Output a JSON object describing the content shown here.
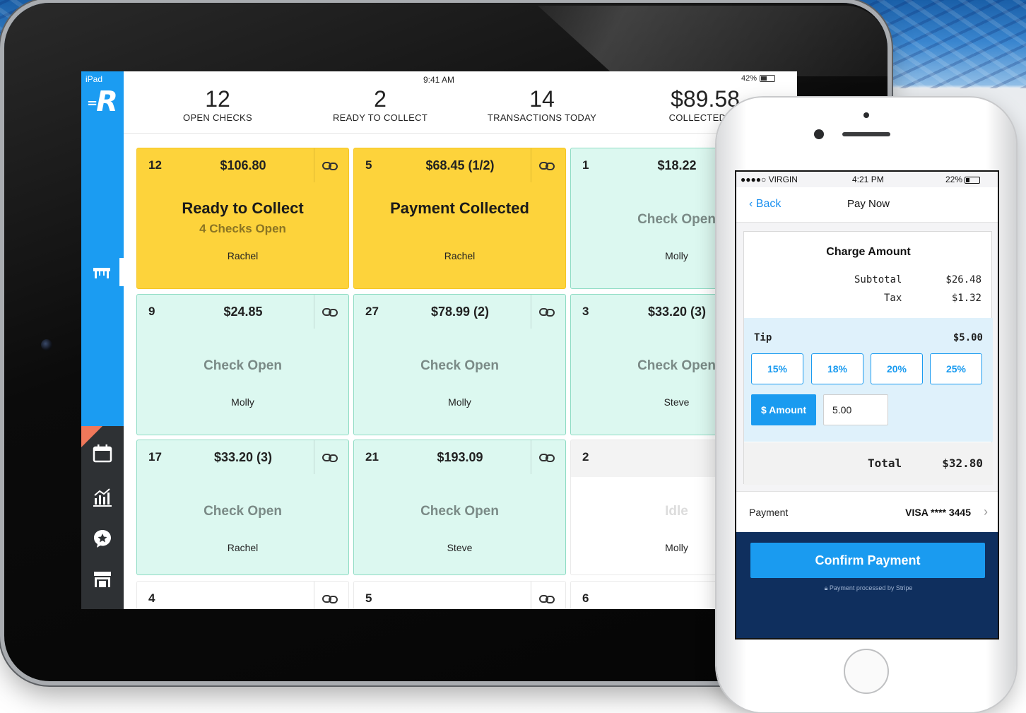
{
  "ipad": {
    "status": {
      "left": "iPad",
      "time": "9:41 AM",
      "battery": "42%"
    },
    "stats": [
      {
        "value": "12",
        "label": "OPEN CHECKS"
      },
      {
        "value": "2",
        "label": "READY TO COLLECT"
      },
      {
        "value": "14",
        "label": "TRANSACTIONS TODAY"
      },
      {
        "value": "$89.58",
        "label": "COLLECTED TO"
      }
    ],
    "cards": [
      {
        "num": "12",
        "amount": "$106.80",
        "status": "Ready to Collect",
        "sub": "4 Checks Open",
        "server": "Rachel",
        "style": "yellow",
        "linked": true
      },
      {
        "num": "5",
        "amount": "$68.45 (1/2)",
        "status": "Payment Collected",
        "sub": "",
        "server": "Rachel",
        "style": "yellow",
        "linked": true
      },
      {
        "num": "1",
        "amount": "$18.22",
        "status": "Check Open",
        "sub": "",
        "server": "Molly",
        "style": "mint",
        "linked": false
      },
      {
        "num": "9",
        "amount": "$24.85",
        "status": "Check Open",
        "sub": "",
        "server": "Molly",
        "style": "mint",
        "linked": true
      },
      {
        "num": "27",
        "amount": "$78.99 (2)",
        "status": "Check Open",
        "sub": "",
        "server": "Molly",
        "style": "mint",
        "linked": true
      },
      {
        "num": "3",
        "amount": "$33.20 (3)",
        "status": "Check Open",
        "sub": "",
        "server": "Steve",
        "style": "mint",
        "linked": false
      },
      {
        "num": "17",
        "amount": "$33.20 (3)",
        "status": "Check Open",
        "sub": "",
        "server": "Rachel",
        "style": "mint",
        "linked": true
      },
      {
        "num": "21",
        "amount": "$193.09",
        "status": "Check Open",
        "sub": "",
        "server": "Steve",
        "style": "mint",
        "linked": true
      },
      {
        "num": "2",
        "amount": "",
        "status": "Idle",
        "sub": "",
        "server": "Molly",
        "style": "idle",
        "linked": false
      },
      {
        "num": "4",
        "amount": "",
        "status": "",
        "sub": "",
        "server": "",
        "style": "idle",
        "linked": true
      },
      {
        "num": "5",
        "amount": "",
        "status": "",
        "sub": "",
        "server": "",
        "style": "idle",
        "linked": true
      },
      {
        "num": "6",
        "amount": "",
        "status": "",
        "sub": "",
        "server": "",
        "style": "idle",
        "linked": false
      }
    ],
    "sidebar_icons": [
      "table-icon",
      "calendar-icon",
      "chart-icon",
      "star-chat-icon",
      "store-icon"
    ]
  },
  "iphone": {
    "status": {
      "carrier": "●●●●○ VIRGIN",
      "time": "4:21 PM",
      "battery": "22%"
    },
    "nav": {
      "back": "Back",
      "title": "Pay Now"
    },
    "charge": {
      "heading": "Charge Amount",
      "subtotal_label": "Subtotal",
      "subtotal": "$26.48",
      "tax_label": "Tax",
      "tax": "$1.32",
      "tip_label": "Tip",
      "tip": "$5.00",
      "tip_options": [
        "15%",
        "18%",
        "20%",
        "25%"
      ],
      "amount_button": "$ Amount",
      "amount_value": "5.00",
      "total_label": "Total",
      "total": "$32.80"
    },
    "payment": {
      "label": "Payment",
      "value": "VISA **** 3445"
    },
    "confirm": "Confirm Payment",
    "stripe_note": "Payment processed by Stripe"
  },
  "colors": {
    "accent": "#1a9bf0",
    "yellow": "#fdd33b",
    "mint": "#dcf8f0",
    "navy": "#0f2f5e"
  }
}
